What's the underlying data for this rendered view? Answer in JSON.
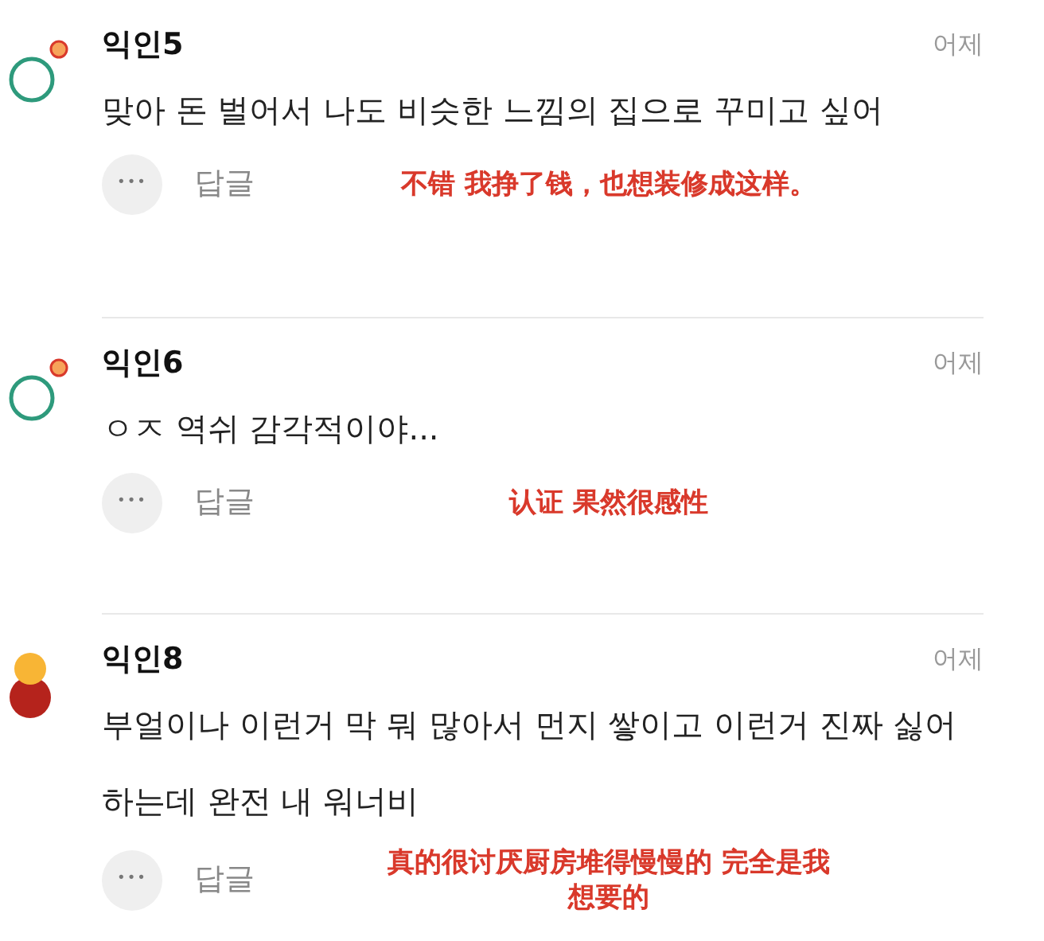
{
  "comments": [
    {
      "author": "익인5",
      "time": "어제",
      "avatar": {
        "kind": "ring"
      },
      "text": "맞아 돈 벌어서 나도 비슷한 느낌의 집으로 꾸미고 싶어",
      "more": "•••",
      "reply": "답글",
      "annotation": "不错 我挣了钱，也想装修成这样。"
    },
    {
      "author": "익인6",
      "time": "어제",
      "avatar": {
        "kind": "ring"
      },
      "text": "ㅇㅈ 역쉬 감각적이야...",
      "more": "•••",
      "reply": "답글",
      "annotation": "认证 果然很感性"
    },
    {
      "author": "익인8",
      "time": "어제",
      "avatar": {
        "kind": "dots"
      },
      "text": "부얼이나 이런거 막 뭐 많아서 먼지 쌓이고 이런거 진짜 싫어하는데 완전 내 워너비",
      "more": "•••",
      "reply": "답글",
      "annotation": "真的很讨厌厨房堆得慢慢的   完全是我想要的"
    }
  ]
}
